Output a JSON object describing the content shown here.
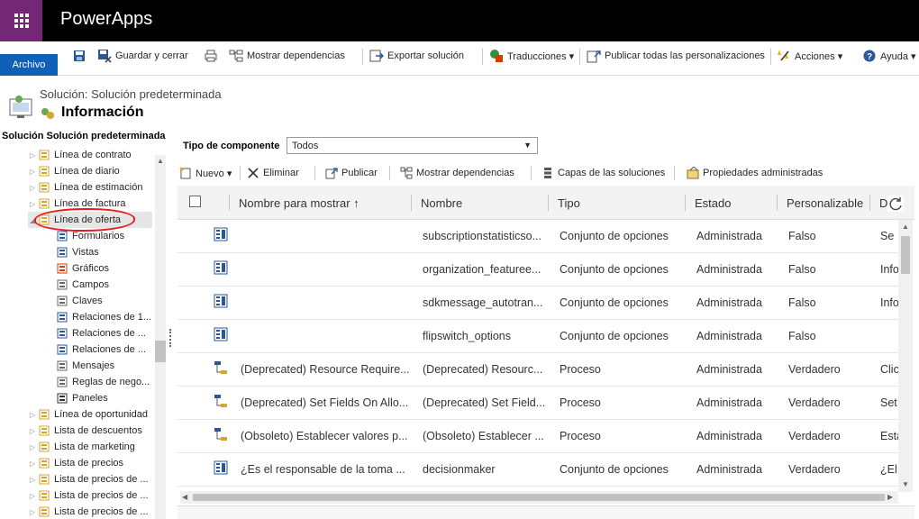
{
  "app": {
    "title": "PowerApps"
  },
  "ribbon": {
    "archivo": "Archivo",
    "items": [
      {
        "label": "",
        "icon": "save-icon"
      },
      {
        "label": "Guardar y cerrar",
        "icon": "save-close-icon"
      },
      {
        "label": "",
        "icon": "print-icon"
      },
      {
        "label": "Mostrar dependencias",
        "icon": "dependencies-icon"
      },
      {
        "label": "Exportar solución",
        "icon": "export-icon"
      },
      {
        "label": "Traducciones ▾",
        "icon": "translations-icon"
      },
      {
        "label": "Publicar todas las personalizaciones",
        "icon": "publish-icon"
      },
      {
        "label": "Acciones ▾",
        "icon": "actions-icon"
      },
      {
        "label": "Ayuda ▾",
        "icon": "help-icon"
      }
    ]
  },
  "header": {
    "solution_label": "Solución: Solución predeterminada",
    "title": "Información"
  },
  "nav": {
    "heading": "Solución Solución predeterminada",
    "items": [
      {
        "label": "Línea de contrato",
        "level": 0,
        "icon": "entity-icon"
      },
      {
        "label": "Línea de diario",
        "level": 0,
        "icon": "entity-icon"
      },
      {
        "label": "Línea de estimación",
        "level": 0,
        "icon": "entity-icon"
      },
      {
        "label": "Línea de factura",
        "level": 0,
        "icon": "entity-icon"
      },
      {
        "label": "Línea de oferta",
        "level": 0,
        "icon": "entity-icon",
        "selected": true,
        "expanded": true
      },
      {
        "label": "Formularios",
        "level": 1,
        "icon": "forms-icon"
      },
      {
        "label": "Vistas",
        "level": 1,
        "icon": "views-icon"
      },
      {
        "label": "Gráficos",
        "level": 1,
        "icon": "charts-icon"
      },
      {
        "label": "Campos",
        "level": 1,
        "icon": "fields-icon"
      },
      {
        "label": "Claves",
        "level": 1,
        "icon": "keys-icon"
      },
      {
        "label": "Relaciones de 1...",
        "level": 1,
        "icon": "relationship-icon"
      },
      {
        "label": "Relaciones de ...",
        "level": 1,
        "icon": "relationship-icon"
      },
      {
        "label": "Relaciones de ...",
        "level": 1,
        "icon": "relationship-icon"
      },
      {
        "label": "Mensajes",
        "level": 1,
        "icon": "messages-icon"
      },
      {
        "label": "Reglas de nego...",
        "level": 1,
        "icon": "business-rules-icon"
      },
      {
        "label": "Paneles",
        "level": 1,
        "icon": "dashboards-icon"
      },
      {
        "label": "Línea de oportunidad",
        "level": 0,
        "icon": "entity-icon"
      },
      {
        "label": "Lista de descuentos",
        "level": 0,
        "icon": "entity-icon"
      },
      {
        "label": "Lista de marketing",
        "level": 0,
        "icon": "entity-icon"
      },
      {
        "label": "Lista de precios",
        "level": 0,
        "icon": "entity-icon"
      },
      {
        "label": "Lista de precios de ...",
        "level": 0,
        "icon": "entity-icon"
      },
      {
        "label": "Lista de precios de ...",
        "level": 0,
        "icon": "entity-icon"
      },
      {
        "label": "Lista de precios de ...",
        "level": 0,
        "icon": "entity-icon"
      }
    ]
  },
  "filter": {
    "label": "Tipo de componente",
    "value": "Todos"
  },
  "toolbar": [
    {
      "label": "Nuevo ▾",
      "icon": "new-icon"
    },
    {
      "label": "Eliminar",
      "icon": "delete-icon"
    },
    {
      "label": "Publicar",
      "icon": "publish-icon"
    },
    {
      "label": "Mostrar dependencias",
      "icon": "dependencies-icon"
    },
    {
      "label": "Capas de las soluciones",
      "icon": "layers-icon"
    },
    {
      "label": "Propiedades administradas",
      "icon": "managed-properties-icon"
    }
  ],
  "grid": {
    "columns": [
      "Nombre para mostrar ↑",
      "Nombre",
      "Tipo",
      "Estado",
      "Personalizable",
      "D"
    ],
    "rows": [
      {
        "icon": "optionset-icon",
        "display": "",
        "name": "subscriptionstatisticso...",
        "type": "Conjunto de opciones",
        "state": "Administrada",
        "custom": "Falso",
        "desc": "Se"
      },
      {
        "icon": "optionset-icon",
        "display": "",
        "name": "organization_featuree...",
        "type": "Conjunto de opciones",
        "state": "Administrada",
        "custom": "Falso",
        "desc": "Info"
      },
      {
        "icon": "optionset-icon",
        "display": "",
        "name": "sdkmessage_autotran...",
        "type": "Conjunto de opciones",
        "state": "Administrada",
        "custom": "Falso",
        "desc": "Info"
      },
      {
        "icon": "optionset-icon",
        "display": "",
        "name": "flipswitch_options",
        "type": "Conjunto de opciones",
        "state": "Administrada",
        "custom": "Falso",
        "desc": ""
      },
      {
        "icon": "process-icon",
        "display": "(Deprecated) Resource Require...",
        "name": "(Deprecated) Resourc...",
        "type": "Proceso",
        "state": "Administrada",
        "custom": "Verdadero",
        "desc": "Clic"
      },
      {
        "icon": "process-icon",
        "display": "(Deprecated) Set Fields On Allo...",
        "name": "(Deprecated) Set Field...",
        "type": "Proceso",
        "state": "Administrada",
        "custom": "Verdadero",
        "desc": "Set"
      },
      {
        "icon": "process-icon",
        "display": "(Obsoleto) Establecer valores p...",
        "name": "(Obsoleto) Establecer ...",
        "type": "Proceso",
        "state": "Administrada",
        "custom": "Verdadero",
        "desc": "Esta"
      },
      {
        "icon": "optionset-icon",
        "display": "¿Es el responsable de la toma ...",
        "name": "decisionmaker",
        "type": "Conjunto de opciones",
        "state": "Administrada",
        "custom": "Verdadero",
        "desc": "¿El"
      }
    ]
  },
  "colors": {
    "topbar": "#000000",
    "waffle": "#742774",
    "archivo": "#1160b7",
    "annotation": "#e8191f"
  }
}
